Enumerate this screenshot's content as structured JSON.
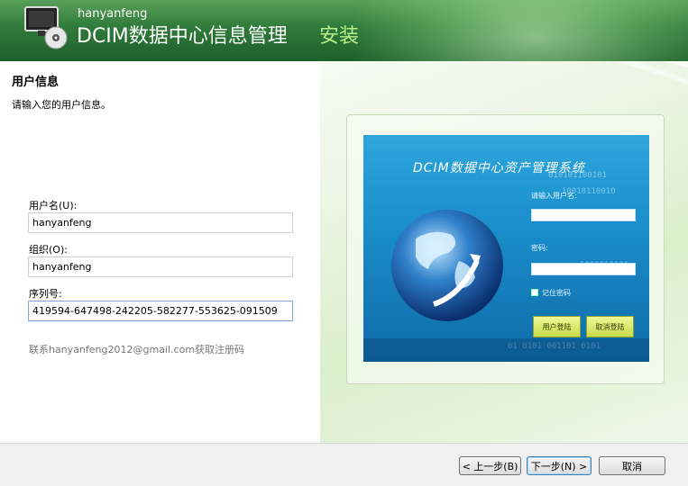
{
  "header": {
    "brand_small": "hanyanfeng",
    "brand_title": "DCIM数据中心信息管理",
    "install_label": "安装"
  },
  "content": {
    "title": "用户信息",
    "subtitle": "请输入您的用户信息。",
    "username_label": "用户名(U):",
    "username_value": "hanyanfeng",
    "org_label": "组织(O):",
    "org_value": "hanyanfeng",
    "serial_label": "序列号:",
    "serial_value": "419594-647498-242205-582277-553625-091509",
    "contact_text": "联系hanyanfeng2012@gmail.com获取注册码"
  },
  "login_card": {
    "title": "DCIM数据中心资产管理系统",
    "username_prompt": "请输入用户名:",
    "password_label": "密码:",
    "remember_label": "记住密码",
    "login_button": "用户登陆",
    "cancel_button": "取消登陆"
  },
  "footer": {
    "back_label": "< 上一步(B)",
    "next_label": "下一步(N) >",
    "cancel_label": "取消"
  },
  "colors": {
    "header_green": "#2f7a3a",
    "install_green": "#b8f08a",
    "card_blue": "#1a8ecb"
  }
}
